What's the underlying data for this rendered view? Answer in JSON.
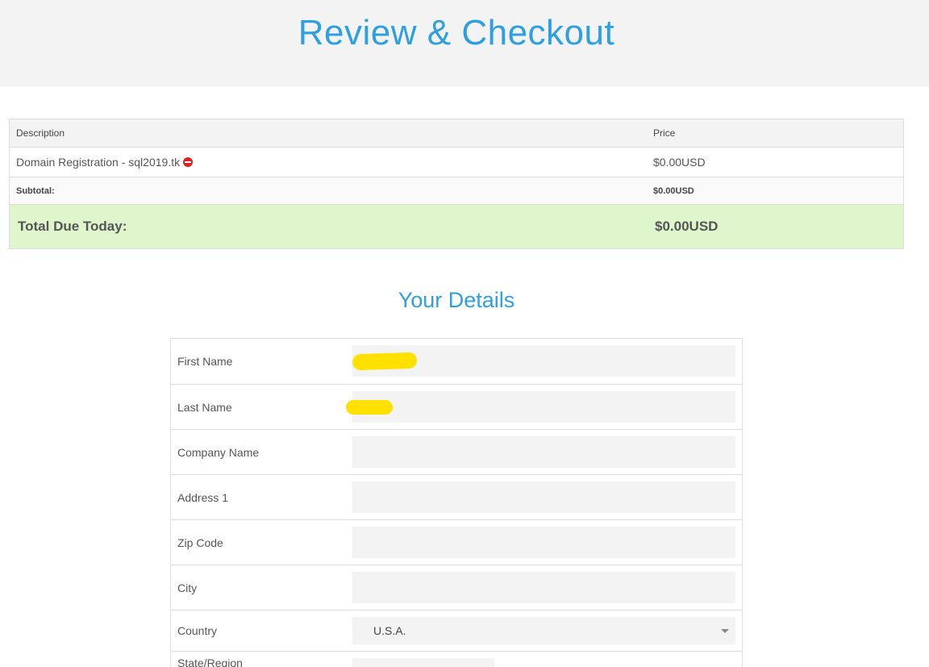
{
  "header": {
    "title": "Review & Checkout"
  },
  "order": {
    "columns": {
      "description": "Description",
      "price": "Price"
    },
    "items": [
      {
        "description": "Domain Registration - sql2019.tk",
        "price": "$0.00USD"
      }
    ],
    "subtotal": {
      "label": "Subtotal:",
      "value": "$0.00USD"
    },
    "total": {
      "label": "Total Due Today:",
      "value": "$0.00USD"
    },
    "colors": {
      "total_bg": "#dff5cc",
      "remove_icon": "#e02020"
    }
  },
  "details": {
    "title": "Your Details",
    "fields": [
      {
        "label": "First Name",
        "value": ""
      },
      {
        "label": "Last Name",
        "value": ""
      },
      {
        "label": "Company Name",
        "value": ""
      },
      {
        "label": "Address 1",
        "value": ""
      },
      {
        "label": "Zip Code",
        "value": ""
      },
      {
        "label": "City",
        "value": ""
      }
    ],
    "country": {
      "label": "Country",
      "selected": "U.S.A."
    },
    "state": {
      "label": "State/Region",
      "selected": ""
    }
  },
  "theme": {
    "accent": "#2e9fe0",
    "input_bg": "#f3f3f3",
    "redaction": "#ffe100"
  }
}
